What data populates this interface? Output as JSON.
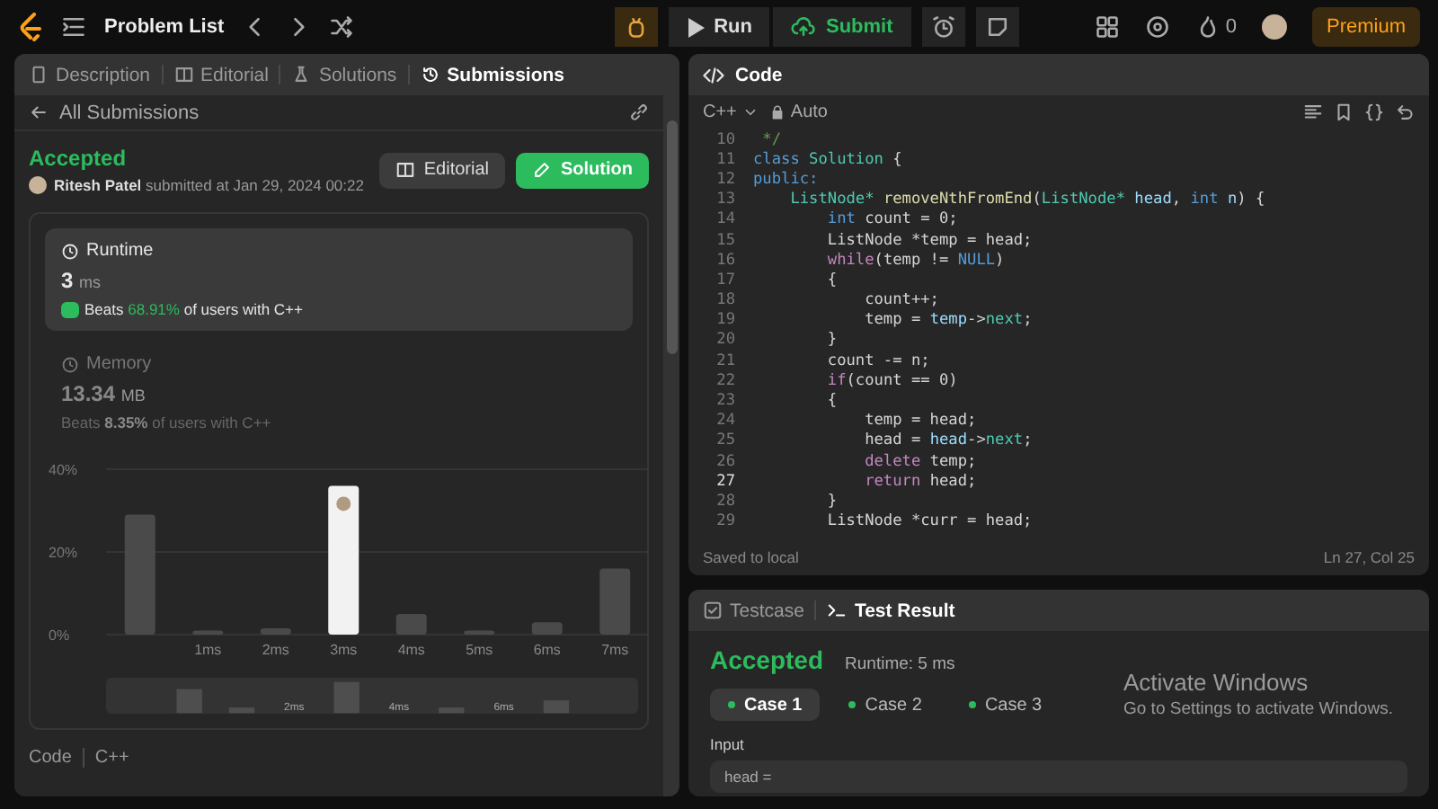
{
  "topbar": {
    "title": "Problem List",
    "run": "Run",
    "submit": "Submit",
    "streak": "0",
    "premium": "Premium"
  },
  "left_tabs": [
    {
      "label": "Description",
      "selected": false
    },
    {
      "label": "Editorial",
      "selected": false
    },
    {
      "label": "Solutions",
      "selected": false
    },
    {
      "label": "Submissions",
      "selected": true
    }
  ],
  "back_link": "All Submissions",
  "submission": {
    "status": "Accepted",
    "user": "Ritesh Patel",
    "submitted": "submitted at Jan 29, 2024 00:22",
    "buttons": [
      {
        "label": "Editorial",
        "kind": "secondary"
      },
      {
        "label": "Solution",
        "kind": "primary"
      }
    ]
  },
  "runtime": {
    "title": "Runtime",
    "value": "3",
    "unit": "ms",
    "beats_label": "Beats",
    "beats": "68.91%",
    "suffix": "of users with C++",
    "selected": true
  },
  "memory": {
    "title": "Memory",
    "value": "13.34",
    "unit": "MB",
    "beats_label": "Beats",
    "beats": "8.35%",
    "suffix": "of users with C++",
    "selected": false
  },
  "chart": {
    "chart_data": {
      "type": "bar",
      "categories": [
        null,
        "1ms",
        "2ms",
        "3ms",
        "4ms",
        "5ms",
        "6ms",
        "7ms"
      ],
      "values": [
        29,
        1,
        1.5,
        36,
        5,
        1,
        3,
        16
      ],
      "ylim": [
        0,
        40
      ],
      "yticks": [
        {
          "value": 0,
          "label": "0%"
        },
        {
          "value": 20,
          "label": "20%"
        },
        {
          "value": 40,
          "label": "40%"
        }
      ],
      "ylabel": null
    },
    "bars": [
      {
        "selected": false
      },
      {
        "selected": false
      },
      {
        "selected": false
      },
      {
        "selected": true
      },
      {
        "selected": false
      },
      {
        "selected": false
      },
      {
        "selected": false
      },
      {
        "selected": false
      }
    ],
    "navigator_labels": [
      "2ms",
      "4ms",
      "6ms"
    ]
  },
  "footer": {
    "label": "Code",
    "language": "C++"
  },
  "code_panel": {
    "title": "Code",
    "language": "C++",
    "mode": "Auto",
    "status": "Saved to local",
    "cursor": "Ln 27, Col 25",
    "lines": [
      {
        "num": "10",
        "current": false,
        "tokens": [
          {
            "text": " */",
            "kind": "comment"
          }
        ]
      },
      {
        "num": "11",
        "current": false,
        "tokens": [
          {
            "text": "class",
            "kind": "keyword"
          },
          {
            "text": " Solution",
            "kind": "type"
          },
          {
            "text": " {",
            "kind": "plain"
          }
        ]
      },
      {
        "num": "12",
        "current": false,
        "tokens": [
          {
            "text": "public:",
            "kind": "keyword"
          }
        ]
      },
      {
        "num": "13",
        "current": false,
        "tokens": [
          {
            "text": "    ListNode*",
            "kind": "type"
          },
          {
            "text": " removeNthFromEnd",
            "kind": "function"
          },
          {
            "text": "(",
            "kind": "plain"
          },
          {
            "text": "ListNode*",
            "kind": "type"
          },
          {
            "text": " head",
            "kind": "variable"
          },
          {
            "text": ", ",
            "kind": "plain"
          },
          {
            "text": "int",
            "kind": "keyword"
          },
          {
            "text": " n",
            "kind": "variable"
          },
          {
            "text": ") {",
            "kind": "plain"
          }
        ]
      },
      {
        "num": "14",
        "current": false,
        "tokens": [
          {
            "text": "        int",
            "kind": "keyword"
          },
          {
            "text": " count = 0;",
            "kind": "plain"
          }
        ]
      },
      {
        "num": "15",
        "current": false,
        "tokens": [
          {
            "text": "        ListNode *temp = head;",
            "kind": "plain"
          }
        ]
      },
      {
        "num": "16",
        "current": false,
        "tokens": [
          {
            "text": "        while",
            "kind": "control"
          },
          {
            "text": "(temp != ",
            "kind": "plain"
          },
          {
            "text": "NULL",
            "kind": "keyword"
          },
          {
            "text": ")",
            "kind": "plain"
          }
        ]
      },
      {
        "num": "17",
        "current": false,
        "tokens": [
          {
            "text": "        {",
            "kind": "plain"
          }
        ]
      },
      {
        "num": "18",
        "current": false,
        "tokens": [
          {
            "text": "            count++;",
            "kind": "plain"
          }
        ]
      },
      {
        "num": "19",
        "current": false,
        "tokens": [
          {
            "text": "            temp = ",
            "kind": "plain"
          },
          {
            "text": "temp",
            "kind": "variable"
          },
          {
            "text": "->",
            "kind": "plain"
          },
          {
            "text": "next",
            "kind": "type"
          },
          {
            "text": ";",
            "kind": "plain"
          }
        ]
      },
      {
        "num": "20",
        "current": false,
        "tokens": [
          {
            "text": "        }",
            "kind": "plain"
          }
        ]
      },
      {
        "num": "21",
        "current": false,
        "tokens": [
          {
            "text": "        count -= n;",
            "kind": "plain"
          }
        ]
      },
      {
        "num": "22",
        "current": false,
        "tokens": [
          {
            "text": "        if",
            "kind": "control"
          },
          {
            "text": "(count == 0)",
            "kind": "plain"
          }
        ]
      },
      {
        "num": "23",
        "current": false,
        "tokens": [
          {
            "text": "        {",
            "kind": "plain"
          }
        ]
      },
      {
        "num": "24",
        "current": false,
        "tokens": [
          {
            "text": "            temp = head;",
            "kind": "plain"
          }
        ]
      },
      {
        "num": "25",
        "current": false,
        "tokens": [
          {
            "text": "            head = ",
            "kind": "plain"
          },
          {
            "text": "head",
            "kind": "variable"
          },
          {
            "text": "->",
            "kind": "plain"
          },
          {
            "text": "next",
            "kind": "type"
          },
          {
            "text": ";",
            "kind": "plain"
          }
        ]
      },
      {
        "num": "26",
        "current": false,
        "tokens": [
          {
            "text": "            delete",
            "kind": "control"
          },
          {
            "text": " temp;",
            "kind": "plain"
          }
        ]
      },
      {
        "num": "27",
        "current": true,
        "tokens": [
          {
            "text": "            return",
            "kind": "control"
          },
          {
            "text": " head;",
            "kind": "plain"
          }
        ]
      },
      {
        "num": "28",
        "current": false,
        "tokens": [
          {
            "text": "        }",
            "kind": "plain"
          }
        ]
      },
      {
        "num": "29",
        "current": false,
        "tokens": [
          {
            "text": "        ListNode *curr = head;",
            "kind": "plain"
          }
        ]
      }
    ]
  },
  "bottom_tabs": [
    {
      "label": "Testcase",
      "selected": false
    },
    {
      "label": "Test Result",
      "selected": true
    }
  ],
  "result": {
    "status": "Accepted",
    "runtime": "Runtime: 5 ms",
    "cases": [
      {
        "label": "Case 1",
        "selected": true,
        "passed": true
      },
      {
        "label": "Case 2",
        "selected": false,
        "passed": true
      },
      {
        "label": "Case 3",
        "selected": false,
        "passed": true
      }
    ],
    "input_label": "Input",
    "input_value": "head ="
  },
  "os_notice": {
    "title": "Activate Windows",
    "text": "Go to Settings to activate Windows."
  }
}
